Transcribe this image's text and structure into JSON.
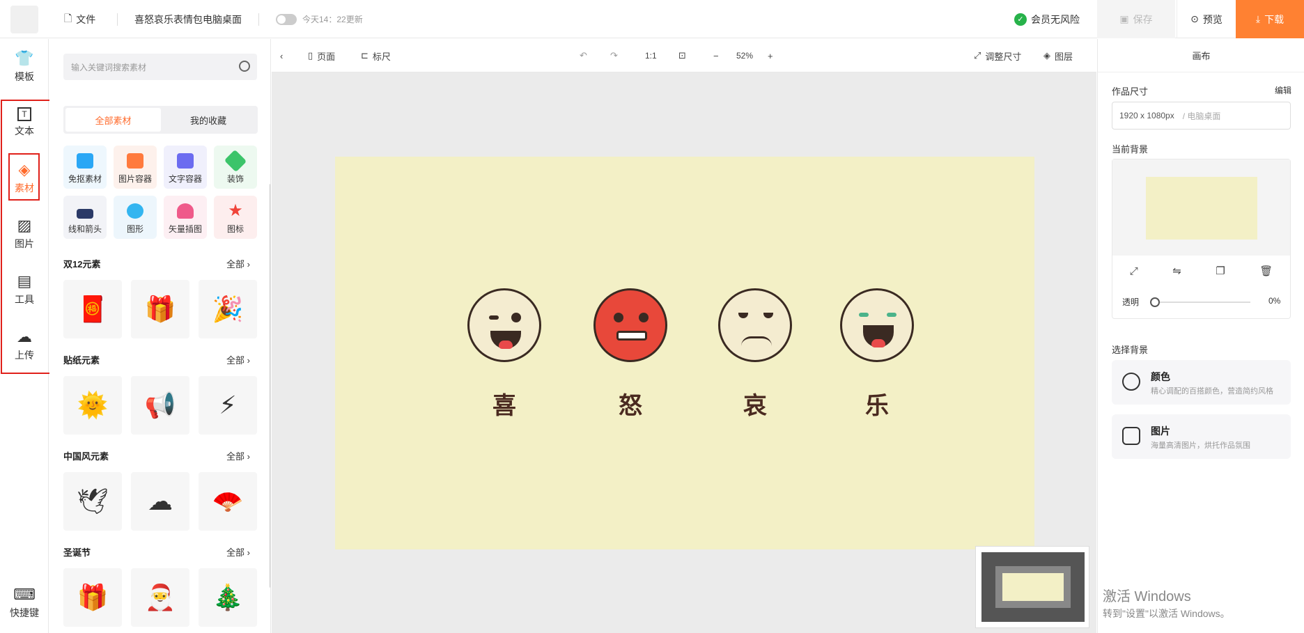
{
  "topbar": {
    "file_label": "文件",
    "doc_title": "喜怒哀乐表情包电脑桌面",
    "autosave_text": "今天14：22更新",
    "risk_text": "会员无风险",
    "save_label": "保存",
    "preview_label": "预览",
    "download_label": "下载",
    "accent_color": "#ff8132"
  },
  "leftnav": {
    "items": [
      {
        "label": "模板",
        "icon": "shirt-icon"
      },
      {
        "label": "文本",
        "icon": "text-icon"
      },
      {
        "label": "素材",
        "icon": "shapes-icon",
        "active": true
      },
      {
        "label": "图片",
        "icon": "image-icon"
      },
      {
        "label": "工具",
        "icon": "toolbox-icon"
      },
      {
        "label": "上传",
        "icon": "cloud-upload-icon"
      }
    ],
    "shortcut_label": "快捷键"
  },
  "panel": {
    "search_placeholder": "输入关键词搜索素材",
    "tab_all": "全部素材",
    "tab_fav": "我的收藏",
    "categories": [
      {
        "label": "免抠素材",
        "color": "#2aa7f5"
      },
      {
        "label": "图片容器",
        "color": "#ff7a3d"
      },
      {
        "label": "文字容器",
        "color": "#6c6cf0"
      },
      {
        "label": "装饰",
        "color": "#3cc46a"
      },
      {
        "label": "线和箭头",
        "color": "#2b3a67"
      },
      {
        "label": "图形",
        "color": "#33b5f0"
      },
      {
        "label": "矢量插图",
        "color": "#ef5a8a"
      },
      {
        "label": "图标",
        "color": "#f0443a"
      }
    ],
    "sections": [
      {
        "title": "双12元素",
        "all": "全部"
      },
      {
        "title": "贴纸元素",
        "all": "全部"
      },
      {
        "title": "中国风元素",
        "all": "全部"
      },
      {
        "title": "圣诞节",
        "all": "全部"
      }
    ]
  },
  "toolbar": {
    "page_label": "页面",
    "ruler_label": "标尺",
    "ratio_label": "1:1",
    "zoom": "52%",
    "resize_label": "调整尺寸",
    "layers_label": "图层"
  },
  "canvas": {
    "background": "#f3f0c6",
    "emotions": [
      "喜",
      "怒",
      "哀",
      "乐"
    ]
  },
  "rightpanel": {
    "title": "画布",
    "size_label": "作品尺寸",
    "edit_label": "编辑",
    "size_value": "1920 x 1080px",
    "size_type": "/ 电脑桌面",
    "current_bg_label": "当前背景",
    "opacity_label": "透明",
    "opacity_value": "0%",
    "choose_bg_label": "选择背景",
    "color_title": "颜色",
    "color_desc": "精心调配的百搭颜色，营造简约风格",
    "image_title": "图片",
    "image_desc": "海量高清图片，烘托作品氛围"
  },
  "watermark": {
    "line1": "激活 Windows",
    "line2": "转到\"设置\"以激活 Windows。"
  }
}
